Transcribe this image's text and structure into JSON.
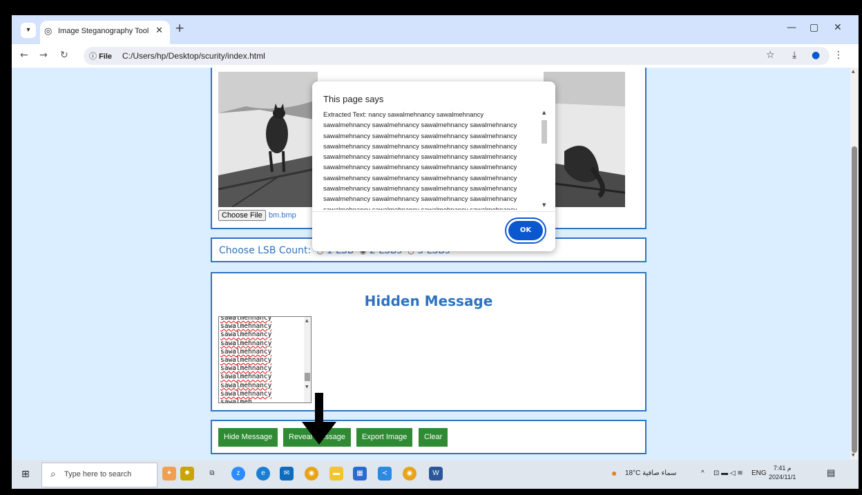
{
  "browser": {
    "tab_title": "Image Steganography Tool",
    "url_scheme": "File",
    "url": "C:/Users/hp/Desktop/scurity/index.html"
  },
  "page": {
    "file_button": "Choose File",
    "file_name": "bm.bmp",
    "lsb_label": "Choose LSB Count:",
    "lsb_options": [
      "1 LSB",
      "2 LSBs",
      "3 LSBs"
    ],
    "lsb_selected": "2 LSBs",
    "hidden_title": "Hidden Message",
    "textarea_lines": [
      "sawalmehnancy",
      "sawalmehnancy",
      "sawalmehnancy",
      "sawalmehnancy",
      "sawalmehnancy",
      "sawalmehnancy",
      "sawalmehnancy",
      "sawalmehnancy",
      "sawalmehnancy",
      "sawalmehnancy",
      "sawalmeh"
    ],
    "buttons": [
      "Hide Message",
      "Reveal Message",
      "Export Image",
      "Clear"
    ]
  },
  "dialog": {
    "title": "This page says",
    "lines": [
      "Extracted Text: nancy sawalmehnancy sawalmehnancy",
      "sawalmehnancy sawalmehnancy sawalmehnancy sawalmehnancy",
      "sawalmehnancy sawalmehnancy sawalmehnancy sawalmehnancy",
      "sawalmehnancy sawalmehnancy sawalmehnancy sawalmehnancy",
      "sawalmehnancy sawalmehnancy sawalmehnancy sawalmehnancy",
      "sawalmehnancy sawalmehnancy sawalmehnancy sawalmehnancy",
      "sawalmehnancy sawalmehnancy sawalmehnancy sawalmehnancy",
      "sawalmehnancy sawalmehnancy sawalmehnancy sawalmehnancy",
      "sawalmehnancy sawalmehnancy sawalmehnancy sawalmehnancy",
      "sawalmehnancy sawalmehnancy sawalmehnancy sawalmehnancy"
    ],
    "ok_label": "OK"
  },
  "taskbar": {
    "search_placeholder": "Type here to search",
    "weather": "18°C سماء صافية",
    "lang": "ENG",
    "time": "7:41 م",
    "date": "2024/11/1"
  },
  "colors": {
    "accent": "#2e72bf",
    "button_green": "#2e8b34",
    "page_bg": "#dbeeff",
    "ok_blue": "#0b57d0"
  }
}
